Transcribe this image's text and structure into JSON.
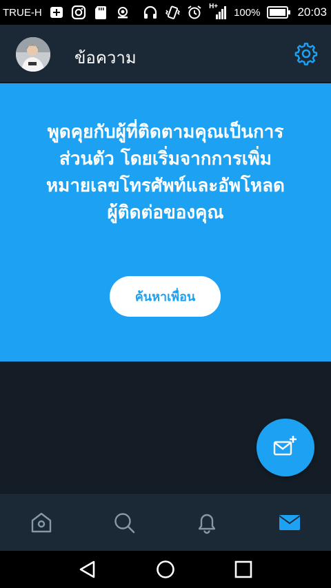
{
  "status_bar": {
    "carrier": "TRUE-H",
    "network": "H+",
    "battery": "100%",
    "time": "20:03"
  },
  "header": {
    "title": "ข้อความ"
  },
  "banner": {
    "message": "พูดคุยกับผู้ที่ติดตามคุณเป็นการส่วนตัว โดยเริ่มจากการเพิ่มหมายเลขโทรศัพท์และอัพโหลดผู้ติดต่อของคุณ",
    "button_label": "ค้นหาเพื่อน"
  },
  "colors": {
    "accent": "#1da1f2",
    "background": "#141d26",
    "bar": "#1b2836",
    "inactive_icon": "#8899a6"
  },
  "tabs": [
    {
      "icon": "home-icon",
      "active": false
    },
    {
      "icon": "search-icon",
      "active": false
    },
    {
      "icon": "bell-icon",
      "active": false
    },
    {
      "icon": "mail-icon",
      "active": true
    }
  ]
}
